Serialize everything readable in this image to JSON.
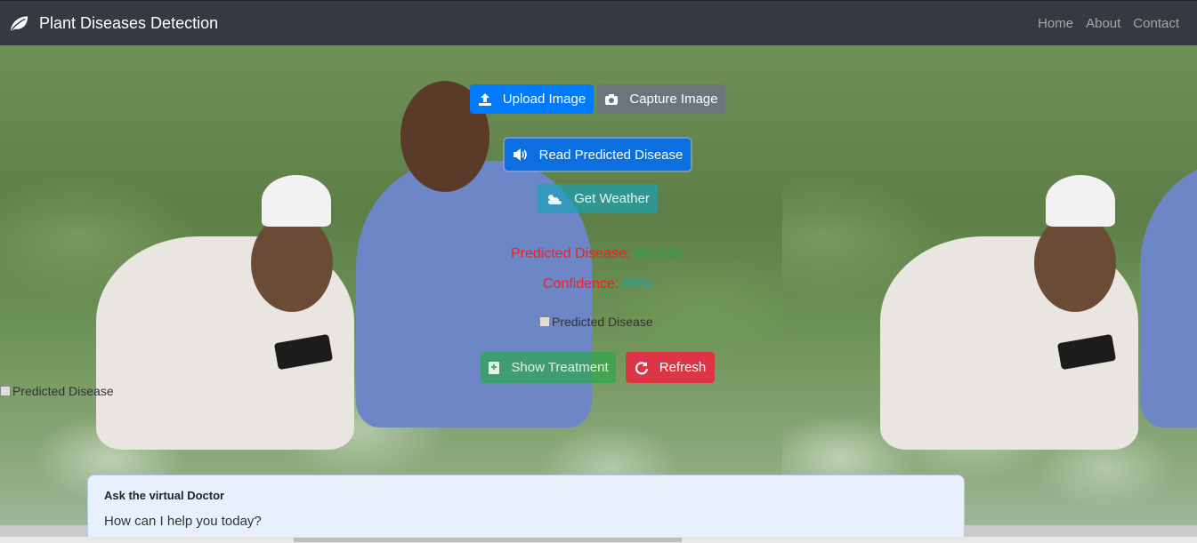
{
  "navbar": {
    "brand": "Plant Diseases Detection",
    "links": [
      "Home",
      "About",
      "Contact"
    ]
  },
  "buttons": {
    "upload": "Upload Image",
    "capture": "Capture Image",
    "read": "Read Predicted Disease",
    "weather": "Get Weather",
    "treatment": "Show Treatment",
    "refresh": "Refresh"
  },
  "result": {
    "disease_label": "Predicted Disease:",
    "disease_value": "Healthy",
    "confidence_label": "Confidence:",
    "confidence_value": "85%"
  },
  "images": {
    "predicted_alt": "Predicted Disease",
    "predicted_alt_2": "Predicted Disease"
  },
  "chat": {
    "title": "Ask the virtual Doctor",
    "message": "How can I help you today?"
  },
  "colors": {
    "navbar": "#343a40",
    "primary": "#007bff",
    "secondary": "#6c757d",
    "info": "#17a2b8",
    "success": "#28a745",
    "danger": "#dc3545"
  }
}
